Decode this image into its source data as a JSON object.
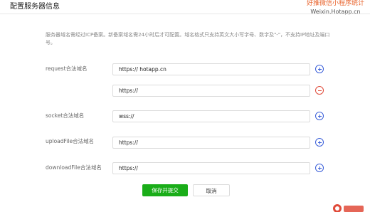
{
  "header": {
    "title": "配置服务器信息"
  },
  "watermark": {
    "line1": "好推微信小程序统计",
    "line2": "Weixin.Hotapp.cn"
  },
  "notice": "服务器域名需经过ICP备案。新备案域名需24小时后才可配置。域名格式只支持英文大小写字母、数字及\"-\"，不支持IP地址及端口号。",
  "rows": [
    {
      "label": "request合法域名",
      "value": "https:// hotapp.cn",
      "action": "add"
    },
    {
      "label": "",
      "value": "https://",
      "action": "remove"
    },
    {
      "label": "socket合法域名",
      "value": "wss://",
      "action": "add"
    },
    {
      "label": "uploadFile合法域名",
      "value": "https://",
      "action": "add"
    },
    {
      "label": "downloadFile合法域名",
      "value": "https://",
      "action": "add"
    }
  ],
  "buttons": {
    "submit": "保存并提交",
    "cancel": "取消"
  },
  "colors": {
    "primary": "#1aad19",
    "add": "#3b5fd9",
    "remove": "#e04b3a",
    "watermark": "#e8632c"
  },
  "icons": {
    "add": "plus-circle-icon",
    "remove": "minus-circle-icon"
  }
}
